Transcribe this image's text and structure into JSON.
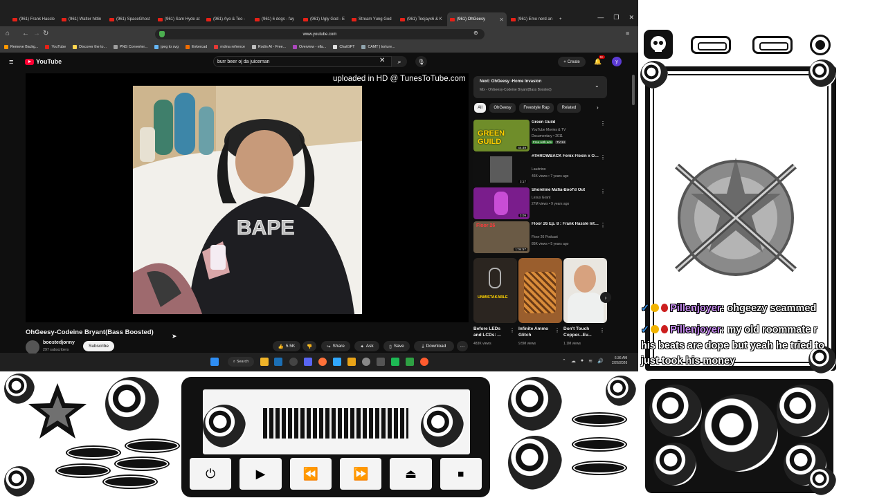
{
  "browser": {
    "tabs": [
      {
        "label": "(961) Frank Hassle"
      },
      {
        "label": "(961) Walter hittin"
      },
      {
        "label": "(961) SpaceGhost"
      },
      {
        "label": "(961) Sam Hyde at"
      },
      {
        "label": "(961) Ayo & Teo -"
      },
      {
        "label": "(961) 6 dogs - fay"
      },
      {
        "label": "(961) Ugly God - E"
      },
      {
        "label": "Stream Yung God"
      },
      {
        "label": "(961) Teejayx6 & K"
      },
      {
        "label": "(961) OhGeesy"
      },
      {
        "label": "(961) Emo nerd an"
      }
    ],
    "url": "www.youtube.com",
    "bookmarks": [
      "Remove Backg...",
      "YouTube",
      "Discover the to...",
      "PNG Converter...",
      "jpeg to svg",
      "Enkercad",
      "mdma refrence",
      "Rodin AI - Free...",
      "Overview - ella...",
      "ChatGPT",
      "CAMT | torture..."
    ]
  },
  "youtube": {
    "logo": "YouTube",
    "search_value": "burr beer oj da juiceman",
    "create_label": "Create",
    "notif_count": "9+",
    "avatar_letter": "y",
    "watermark": "uploaded in HD @ TunesToTube.com",
    "video_title": "OhGeesy-Codeine Bryant(Bass Boosted)",
    "channel_name": "boostedjonny",
    "channel_subs": "297 subscribers",
    "subscribe_label": "Subscribe",
    "likes": "5.5K",
    "share_label": "Share",
    "ask_label": "Ask",
    "save_label": "Save",
    "download_label": "Download",
    "next_title": "Next: OhGeesy -Home Invasion",
    "next_sub": "Mix - OhGeesy-Codeine Bryant(Bass Boosted)",
    "chips": [
      "All",
      "OhGeesy",
      "Freestyle Rap",
      "Related"
    ],
    "recs": [
      {
        "title": "Green Guild",
        "channel": "YouTube Movies & TV",
        "meta": "Documentary • 2011",
        "badge1": "Free with ads",
        "badge2": "TV-14",
        "duration": "44:49",
        "thumb_text": "GREEN GUILD"
      },
      {
        "title": "#THROWBACK Fenix Flexin x Ohgeesy - Stop Play'n (Prod. ...",
        "channel": "Laudnino",
        "meta": "46K views • 7 years ago",
        "duration": "3:17"
      },
      {
        "title": "Shoreline Mafia-Boof'd Out",
        "channel": "Lexus Grant",
        "meta": "27M views • 9 years ago",
        "duration": "3:09"
      },
      {
        "title": "Floor 26 Ep. 8 : Frank Hassle Interview, Boogie2988 Feud, ...",
        "channel": "Floor 26 Podcast",
        "meta": "85K views • 5 years ago",
        "duration": "1:04:57",
        "thumb_text": "Floor 26"
      }
    ],
    "shorts": [
      {
        "title": "Before LEDs and LCDs: ...",
        "views": "483K views",
        "thumb_text": "UNMISTAKABLE"
      },
      {
        "title": "Infinite Ammo Glitch",
        "views": "9.5M views"
      },
      {
        "title": "Don't Touch Copper...Ev...",
        "views": "1.1M views"
      }
    ]
  },
  "taskbar": {
    "search_label": "Search",
    "time": "6:36 AM",
    "date": "2/26/2026"
  },
  "chat": [
    {
      "user": "Pillenjoyer",
      "message": "ohgeezy scammed"
    },
    {
      "user": "Pillenjoyer",
      "message": "my old roommate r"
    }
  ],
  "chat_overflow": [
    "his beats are dope but yeah he tried to",
    "just took his money"
  ],
  "colors": {
    "yt_red": "#ff0033",
    "chat_user": "#c68cf0",
    "page_bg": "#0f0f0f"
  }
}
